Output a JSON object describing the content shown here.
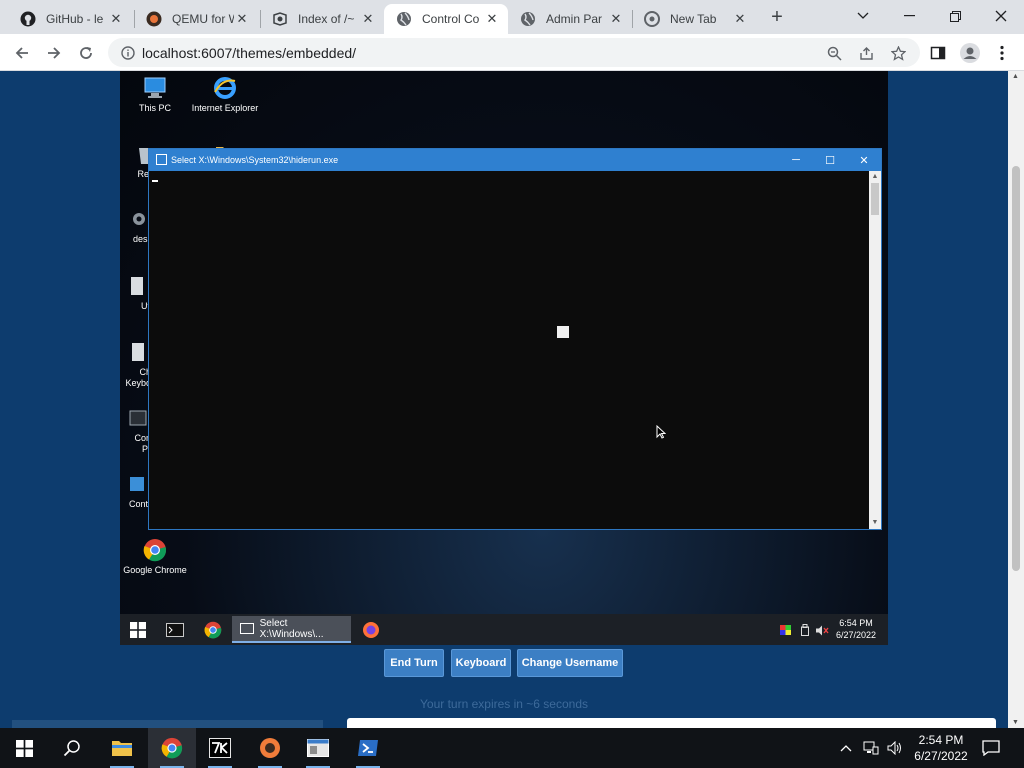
{
  "browser": {
    "tabs": [
      {
        "label": "GitHub - le",
        "icon": "github-icon"
      },
      {
        "label": "QEMU for W",
        "icon": "qemu-icon"
      },
      {
        "label": "Index of /~",
        "icon": "index-icon"
      },
      {
        "label": "Control Co",
        "icon": "globe-icon",
        "active": true
      },
      {
        "label": "Admin Par",
        "icon": "globe-icon"
      },
      {
        "label": "New Tab",
        "icon": "chrome-icon"
      }
    ],
    "url": "localhost:6007/themes/embedded/"
  },
  "vm": {
    "desktop_icons": [
      {
        "label": "This PC"
      },
      {
        "label": "Internet Explorer"
      },
      {
        "label": "Recy"
      },
      {
        "label": "desk"
      },
      {
        "label": "Ut"
      },
      {
        "label": "Ch\nKeybo"
      },
      {
        "label": "Con\nPr"
      },
      {
        "label": "Conti"
      },
      {
        "label": "Google Chrome"
      }
    ],
    "console": {
      "title": "Select X:\\Windows\\System32\\hiderun.exe"
    },
    "taskbar": {
      "active_window": "Select X:\\Windows\\...",
      "time": "6:54 PM",
      "date": "6/27/2022"
    }
  },
  "controls": {
    "end_turn": "End Turn",
    "keyboard": "Keyboard",
    "change_username": "Change Username",
    "expire_text": "Your turn expires in ~6 seconds"
  },
  "host_taskbar": {
    "time": "2:54 PM",
    "date": "6/27/2022"
  },
  "colors": {
    "page_bg": "#0d3c6e",
    "console_title": "#2f80d0",
    "button": "#3c7fc4"
  }
}
